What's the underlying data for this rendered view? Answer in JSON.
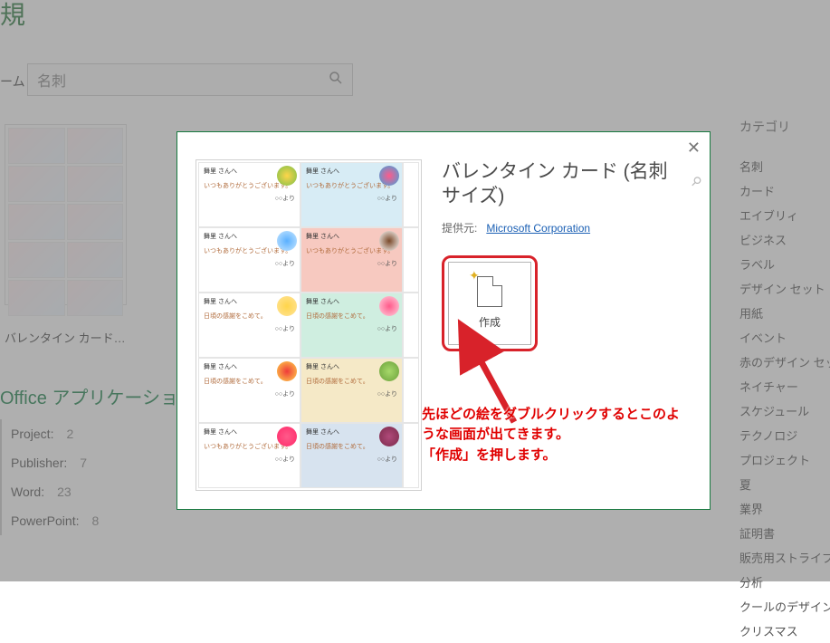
{
  "page": {
    "title_fragment": "規",
    "home_fragment": "ーム"
  },
  "search": {
    "value": "名刺",
    "icon": "search-icon"
  },
  "background_thumb": {
    "label": "バレンタイン カード (…"
  },
  "apps": {
    "heading": "Office アプリケーション",
    "items": [
      {
        "name": "Project:",
        "count": "2"
      },
      {
        "name": "Publisher:",
        "count": "7"
      },
      {
        "name": "Word:",
        "count": "23"
      },
      {
        "name": "PowerPoint:",
        "count": "8"
      }
    ]
  },
  "sidebar": {
    "heading": "カテゴリ",
    "categories": [
      "名刺",
      "カード",
      "エイブリィ",
      "ビジネス",
      "ラベル",
      "デザイン セット",
      "用紙",
      "イベント",
      "赤のデザイン セット",
      "ネイチャー",
      "スケジュール",
      "テクノロジ",
      "プロジェクト",
      "夏",
      "業界",
      "証明書",
      "販売用ストライプの",
      "分析",
      "クールのデザイン セ",
      "クリスマス"
    ]
  },
  "modal": {
    "template_title": "バレンタイン カード (名刺サイズ)",
    "provider_label": "提供元:",
    "provider_name": "Microsoft Corporation",
    "create_label": "作成",
    "annotation": "先ほどの絵をダブルクリックするとこのような画面が出てきます。\n「作成」を押します。",
    "cards": {
      "to": "舞里 さんへ",
      "msg_a": "いつもありがとうございます。",
      "msg_b": "日頃の感謝をこめて。",
      "from": "○○より"
    }
  }
}
